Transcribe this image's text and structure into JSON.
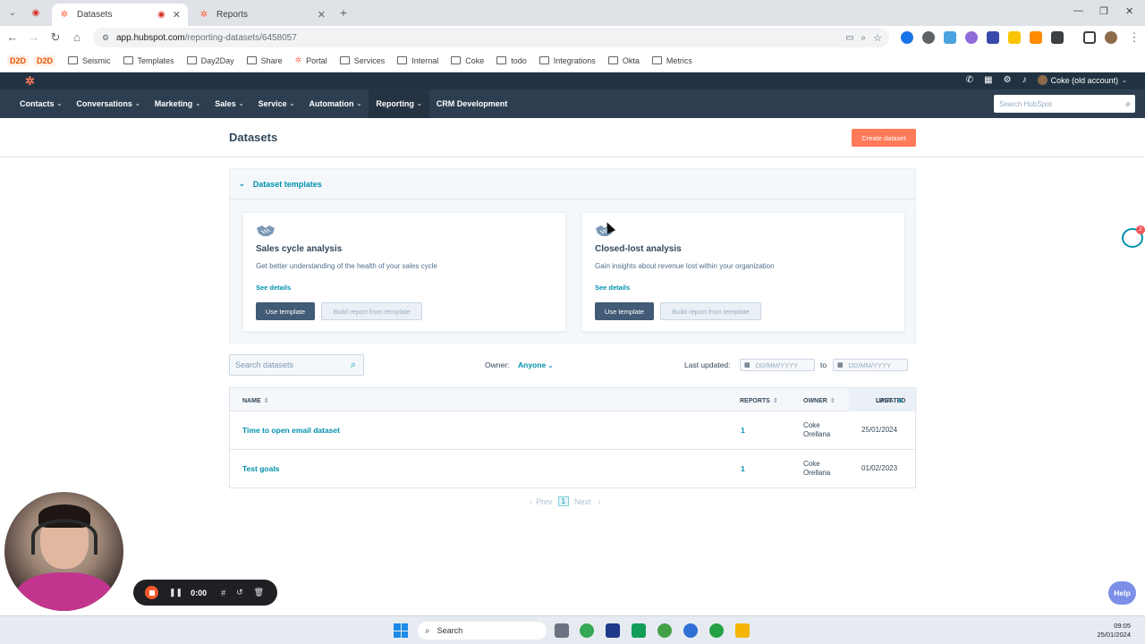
{
  "browser": {
    "tabs": [
      {
        "label": "Datasets",
        "active": true
      },
      {
        "label": "Reports",
        "active": false
      }
    ],
    "url_host": "app.hubspot.com",
    "url_path": "/reporting-datasets/6458057",
    "bookmarks": [
      "D2D",
      "D2D",
      "Seismic",
      "Templates",
      "Day2Day",
      "Share",
      "Portal",
      "Services",
      "Internal",
      "Coke",
      "todo",
      "Integrations",
      "Okta",
      "Metrics"
    ]
  },
  "hubspot": {
    "account": "Coke (old account)",
    "nav": [
      {
        "label": "Contacts",
        "caret": true
      },
      {
        "label": "Conversations",
        "caret": true
      },
      {
        "label": "Marketing",
        "caret": true
      },
      {
        "label": "Sales",
        "caret": true
      },
      {
        "label": "Service",
        "caret": true
      },
      {
        "label": "Automation",
        "caret": true
      },
      {
        "label": "Reporting",
        "caret": true,
        "active": true
      },
      {
        "label": "CRM Development",
        "caret": false
      }
    ],
    "search_placeholder": "Search HubSpot"
  },
  "page": {
    "title": "Datasets",
    "create_button": "Create dataset",
    "templates_header": "Dataset templates",
    "templates": [
      {
        "title": "Sales cycle analysis",
        "description": "Get better understanding of the health of your sales cycle",
        "details": "See details",
        "use": "Use template",
        "build": "Build report from template"
      },
      {
        "title": "Closed-lost analysis",
        "description": "Gain insights about revenue lost within your organization",
        "details": "See details",
        "use": "Use template",
        "build": "Build report from template"
      }
    ],
    "filters": {
      "search_placeholder": "Search datasets",
      "owner_label": "Owner:",
      "owner_value": "Anyone",
      "updated_label": "Last updated:",
      "date_placeholder": "DD/MM/YYYY",
      "to_label": "to"
    },
    "table": {
      "headers": {
        "name": "NAME",
        "reports": "REPORTS",
        "owner": "OWNER",
        "last_updated_1": "LAST",
        "last_updated_2": "UPDATED"
      },
      "rows": [
        {
          "name": "Time to open email dataset",
          "reports": "1",
          "owner_1": "Coke",
          "owner_2": "Orellana",
          "updated": "25/01/2024"
        },
        {
          "name": "Test goals",
          "reports": "1",
          "owner_1": "Coke",
          "owner_2": "Orellana",
          "updated": "01/02/2023"
        }
      ]
    },
    "pagination": {
      "prev": "Prev",
      "page": "1",
      "next": "Next"
    }
  },
  "widgets": {
    "recorder_time": "0:00",
    "help": "Help",
    "chat_badge": "2"
  },
  "taskbar": {
    "search": "Search",
    "time": "09:05",
    "date": "25/01/2024"
  }
}
